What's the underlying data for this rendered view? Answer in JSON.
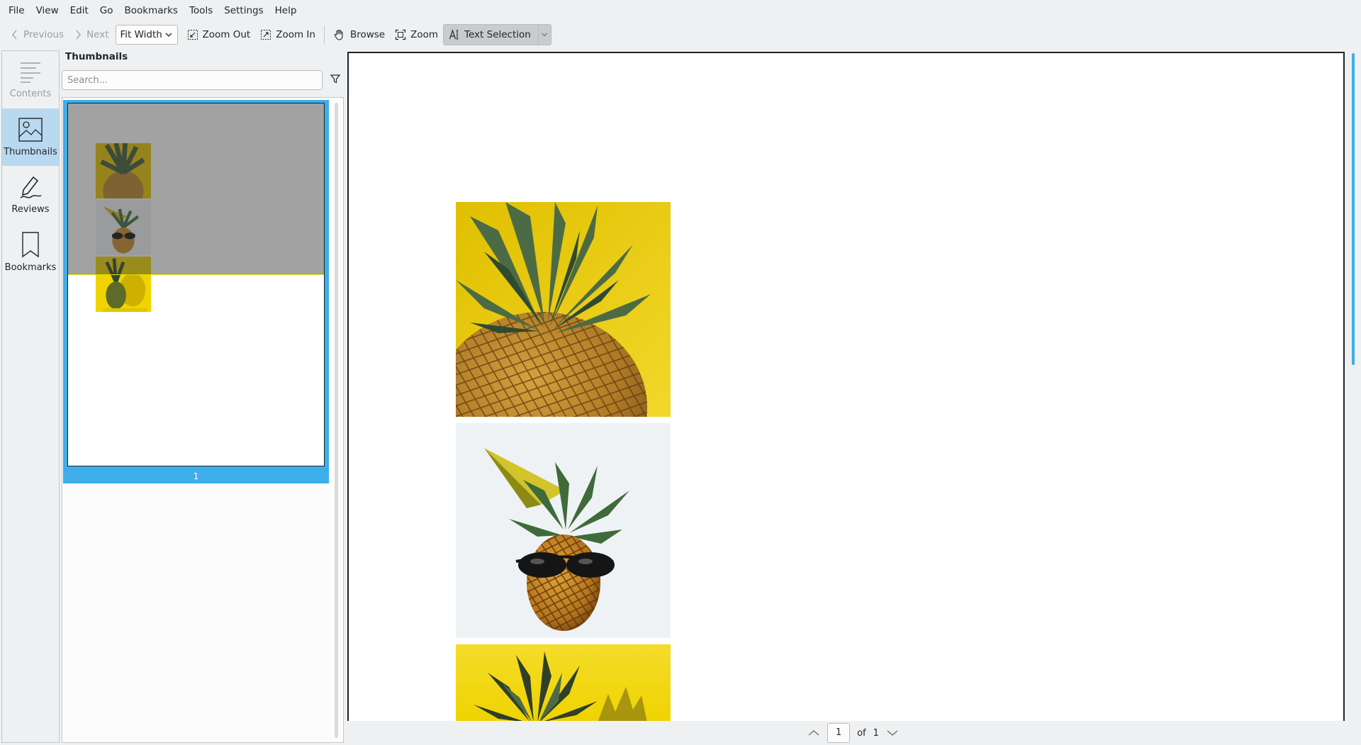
{
  "menubar": {
    "items": [
      "File",
      "View",
      "Edit",
      "Go",
      "Bookmarks",
      "Tools",
      "Settings",
      "Help"
    ]
  },
  "toolbar": {
    "previous_label": "Previous",
    "next_label": "Next",
    "zoom_mode": "Fit Width",
    "zoom_out_label": "Zoom Out",
    "zoom_in_label": "Zoom In",
    "browse_label": "Browse",
    "zoom_label": "Zoom",
    "text_selection_label": "Text Selection"
  },
  "sidebar": {
    "items": [
      {
        "label": "Contents",
        "icon": "contents-icon",
        "state": "disabled"
      },
      {
        "label": "Thumbnails",
        "icon": "thumbnails-icon",
        "state": "selected"
      },
      {
        "label": "Reviews",
        "icon": "reviews-icon",
        "state": "normal"
      },
      {
        "label": "Bookmarks",
        "icon": "bookmarks-icon",
        "state": "normal"
      }
    ]
  },
  "thumbnails_panel": {
    "title": "Thumbnails",
    "search_placeholder": "Search...",
    "pages": [
      {
        "number": "1"
      }
    ]
  },
  "document": {
    "images": [
      {
        "name": "pineapple-on-yellow"
      },
      {
        "name": "pineapple-party-hat-sunglasses"
      },
      {
        "name": "pineapple-with-shadow"
      }
    ]
  },
  "pager": {
    "current_page": "1",
    "of_label": "of",
    "total_pages": "1"
  },
  "colors": {
    "accent": "#3daee9",
    "selection_light": "#b9d9f0",
    "yellow": "#f1d100"
  }
}
